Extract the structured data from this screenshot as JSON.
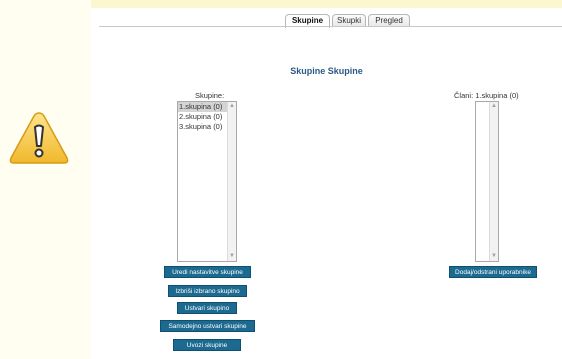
{
  "tabs": [
    {
      "label": "Skupine",
      "active": true
    },
    {
      "label": "Skupki",
      "active": false
    },
    {
      "label": "Pregled",
      "active": false
    }
  ],
  "heading": "Skupine Skupine",
  "groups": {
    "label": "Skupine:",
    "items": [
      "1.skupina (0)",
      "2.skupina (0)",
      "3.skupina (0)"
    ],
    "selected_index": 0
  },
  "members": {
    "label": "Člani: 1.skupina (0)",
    "items": []
  },
  "buttons": {
    "edit_settings": "Uredi nastavitve skupine",
    "delete_selected": "Izbriši izbrano skupino",
    "create": "Ustvari skupino",
    "auto_create": "Samodejno ustvari skupine",
    "import": "Uvozi skupine",
    "add_remove_users": "Dodaj/odstrani uporabnike"
  },
  "colors": {
    "button_bg": "#1c6a8f",
    "heading": "#2a5a85",
    "page_bg": "#fffef0",
    "warning": "#f2c94c"
  },
  "icons": {
    "warning": "warning-icon"
  }
}
